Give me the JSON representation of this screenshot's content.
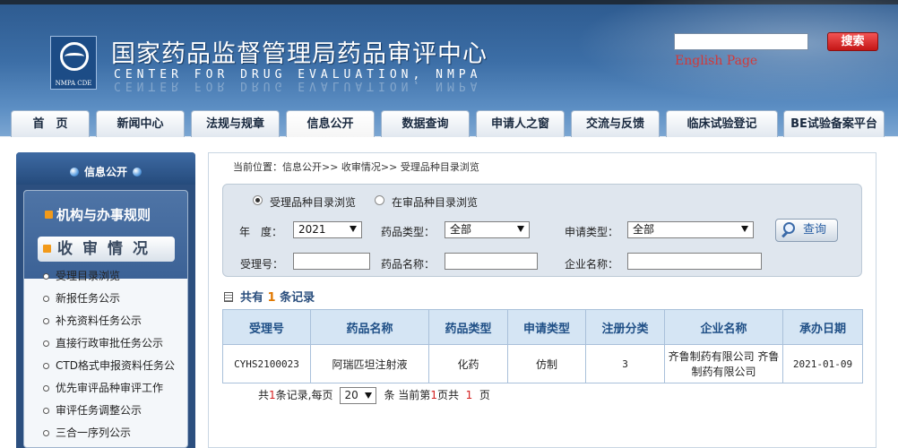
{
  "header": {
    "title_cn": "国家药品监督管理局药品审评中心",
    "title_en": "CENTER  FOR  DRUG  EVALUATION,  NMPA",
    "logo_text": "NMPA CDE",
    "search_button": "搜索",
    "search_value": "",
    "english_link": "English Page"
  },
  "nav": {
    "tabs": [
      "首　页",
      "新闻中心",
      "法规与规章",
      "信息公开",
      "数据查询",
      "申请人之窗",
      "交流与反馈",
      "临床试验登记",
      "BE试验备案平台"
    ],
    "active": "信息公开"
  },
  "sidebar": {
    "title": "信息公开",
    "category1": "机构与办事规则",
    "category2": "收审情况",
    "items": [
      "受理目录浏览",
      "新报任务公示",
      "补充资料任务公示",
      "直接行政审批任务公示",
      "CTD格式申报资料任务公",
      "优先审评品种审评工作",
      "审评任务调整公示",
      "三合一序列公示"
    ]
  },
  "breadcrumb": "当前位置：信息公开>> 收审情况>> 受理品种目录浏览",
  "filters": {
    "radio1": "受理品种目录浏览",
    "radio2": "在审品种目录浏览",
    "year_label": "年　度：",
    "year_value": "2021",
    "drug_type_label": "药品类型：",
    "drug_type_value": "全部",
    "apply_type_label": "申请类型：",
    "apply_type_value": "全部",
    "query_button": "查询",
    "accept_no_label": "受理号：",
    "drug_name_label": "药品名称：",
    "company_label": "企业名称："
  },
  "records": {
    "prefix": "共有",
    "count": "1",
    "suffix": "条记录"
  },
  "table": {
    "headers": [
      "受理号",
      "药品名称",
      "药品类型",
      "申请类型",
      "注册分类",
      "企业名称",
      "承办日期"
    ],
    "rows": [
      [
        "CYHS2100023",
        "阿瑞匹坦注射液",
        "化药",
        "仿制",
        "3",
        "齐鲁制药有限公司 齐鲁制药有限公司",
        "2021-01-09"
      ]
    ]
  },
  "pager": {
    "t1": "共",
    "total": "1",
    "t2": "条记录,每页",
    "page_size": "20",
    "t3": "条 当前第",
    "current": "1",
    "t4": "页共",
    "pages": "1",
    "t5": "页"
  },
  "colors": {
    "header_blue": "#3c6ea6",
    "search_red": "#d42020",
    "table_header": "#d5e5f4",
    "accent_orange": "#e07800"
  }
}
